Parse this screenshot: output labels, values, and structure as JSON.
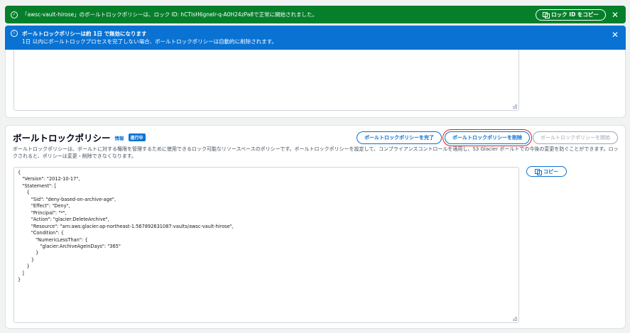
{
  "flash_success": {
    "message": "「awsc-vault-hirose」のボールトロックポリシーは、ロック ID: hCTIsH6gneIr-q-A0H24zPa8で正常に開始されました。",
    "copy_lock_id_label": "ロック ID をコピー",
    "close_glyph": "✕",
    "color": "#067f2b"
  },
  "flash_info": {
    "title": "ボールトロックポリシーは約 1日 で無効になります",
    "message": "1日 以内にボールトロックプロセスを完了しない場合、ボールトロックポリシーは自動的に削除されます。",
    "close_glyph": "✕",
    "color": "#0972d3"
  },
  "policy_section": {
    "title": "ボールトロックポリシー",
    "info_link": "情報",
    "status_badge": "進行中",
    "buttons": {
      "complete": "ボールトロックポリシーを完了",
      "delete": "ボールトロックポリシーを削除",
      "start": "ボールトロックポリシーを開始"
    },
    "description": "ボールトロックポリシーは、ボールトに対する権限を管理するために使用できるロック可能なリソースベースのポリシーです。ボールトロックポリシーを設定して、コンプライアンスコントロールを適用し、S3 Glacier ボールトでの今後の変更を防ぐことができます。ロックされると、ポリシーは変更・削除できなくなります。",
    "copy_label": "コピー",
    "policy_json": "{\n   \"Version\": \"2012-10-17\",\n   \"Statement\": [\n      {\n         \"Sid\": \"deny-based-on-archive-age\",\n         \"Effect\": \"Deny\",\n         \"Principal\": \"*\",\n         \"Action\": \"glacier:DeleteArchive\",\n         \"Resource\": \"arn:aws:glacier:ap-northeast-1:567892631087:vaults/awsc-vault-hirose\",\n         \"Condition\": {\n            \"NumericLessThan\": {\n               \"glacier:ArchiveAgeInDays\": \"365\"\n            }\n         }\n      }\n   ]\n}"
  }
}
